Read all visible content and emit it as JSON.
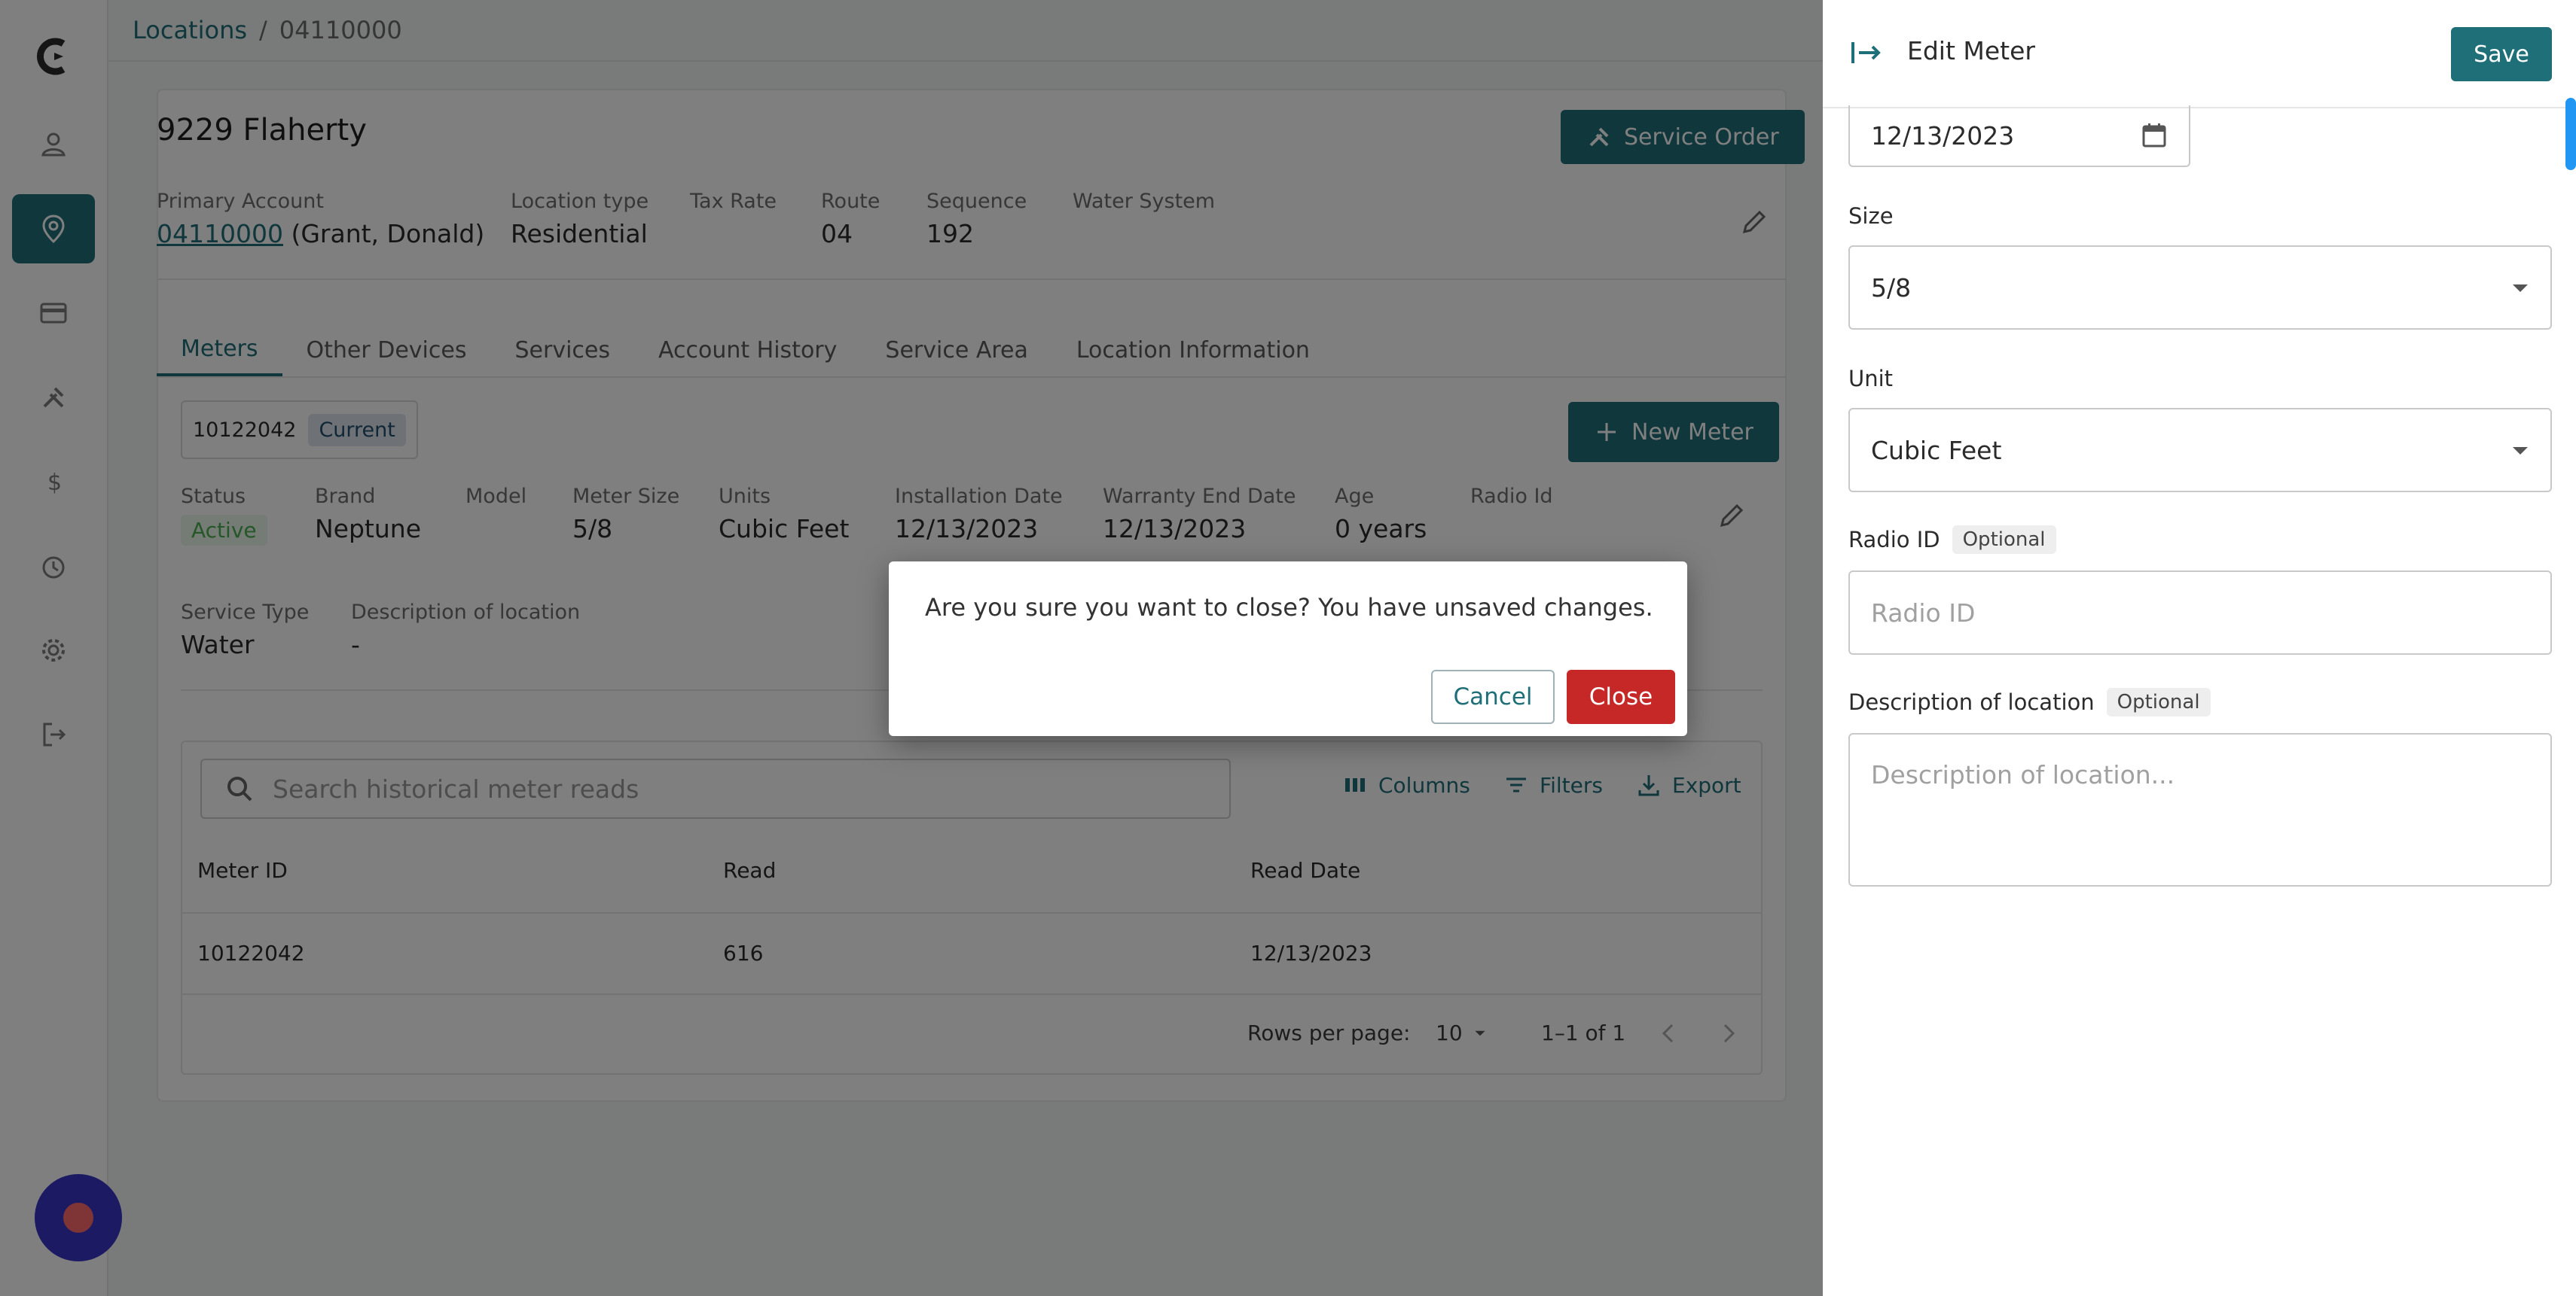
{
  "breadcrumb": {
    "link": "Locations",
    "separator": "/",
    "current": "04110000"
  },
  "location": {
    "title": "9229 Flaherty",
    "service_order_label": "Service Order",
    "fields": [
      {
        "label": "Primary Account",
        "value_link": "04110000",
        "value_rest": " (Grant, Donald)"
      },
      {
        "label": "Location type",
        "value": "Residential"
      },
      {
        "label": "Tax Rate",
        "value": ""
      },
      {
        "label": "Route",
        "value": "04"
      },
      {
        "label": "Sequence",
        "value": "192"
      },
      {
        "label": "Water System",
        "value": ""
      }
    ]
  },
  "tabs": [
    "Meters",
    "Other Devices",
    "Services",
    "Account History",
    "Service Area",
    "Location Information"
  ],
  "meter": {
    "id": "10122042",
    "badge": "Current",
    "new_meter_label": "New Meter",
    "status_label": "Status",
    "status_value": "Active",
    "brand_label": "Brand",
    "brand_value": "Neptune",
    "model_label": "Model",
    "model_value": "",
    "size_label": "Meter Size",
    "size_value": "5/8",
    "units_label": "Units",
    "units_value": "Cubic Feet",
    "install_label": "Installation Date",
    "install_value": "12/13/2023",
    "warranty_label": "Warranty End Date",
    "warranty_value": "12/13/2023",
    "age_label": "Age",
    "age_value": "0 years",
    "radio_label": "Radio Id",
    "radio_value": "",
    "service_type_label": "Service Type",
    "service_type_value": "Water",
    "desc_label": "Description of location",
    "desc_value": "-"
  },
  "reads": {
    "search_placeholder": "Search historical meter reads",
    "columns_label": "Columns",
    "filters_label": "Filters",
    "export_label": "Export",
    "headers": [
      "Meter ID",
      "Read",
      "Read Date"
    ],
    "rows": [
      [
        "10122042",
        "616",
        "12/13/2023"
      ]
    ],
    "rows_per_page_label": "Rows per page:",
    "rows_per_page_value": "10",
    "range": "1–1 of 1"
  },
  "dialog": {
    "message": "Are you sure you want to close? You have unsaved changes.",
    "cancel": "Cancel",
    "close": "Close"
  },
  "panel": {
    "title": "Edit Meter",
    "save": "Save",
    "date_value": "12/13/2023",
    "size_label": "Size",
    "size_value": "5/8",
    "unit_label": "Unit",
    "unit_value": "Cubic Feet",
    "radio_label": "Radio ID",
    "radio_optional": "Optional",
    "radio_placeholder": "Radio ID",
    "desc_label": "Description of location",
    "desc_optional": "Optional",
    "desc_placeholder": "Description of location..."
  },
  "colors": {
    "accent": "#1f6f78",
    "danger": "#c62828",
    "active": "#4caf50",
    "chat": "#3a35c9"
  },
  "icons": [
    "logo-icon",
    "person-icon",
    "location-pin-icon",
    "card-icon",
    "tools-icon",
    "dollar-icon",
    "alarm-icon",
    "gear-icon",
    "logout-icon",
    "chat-icon",
    "pencil-icon",
    "plus-icon",
    "search-icon",
    "columns-icon",
    "filter-icon",
    "export-icon",
    "calendar-icon",
    "chevron-down-icon",
    "chevron-left-icon",
    "chevron-right-icon",
    "panel-collapse-icon"
  ]
}
